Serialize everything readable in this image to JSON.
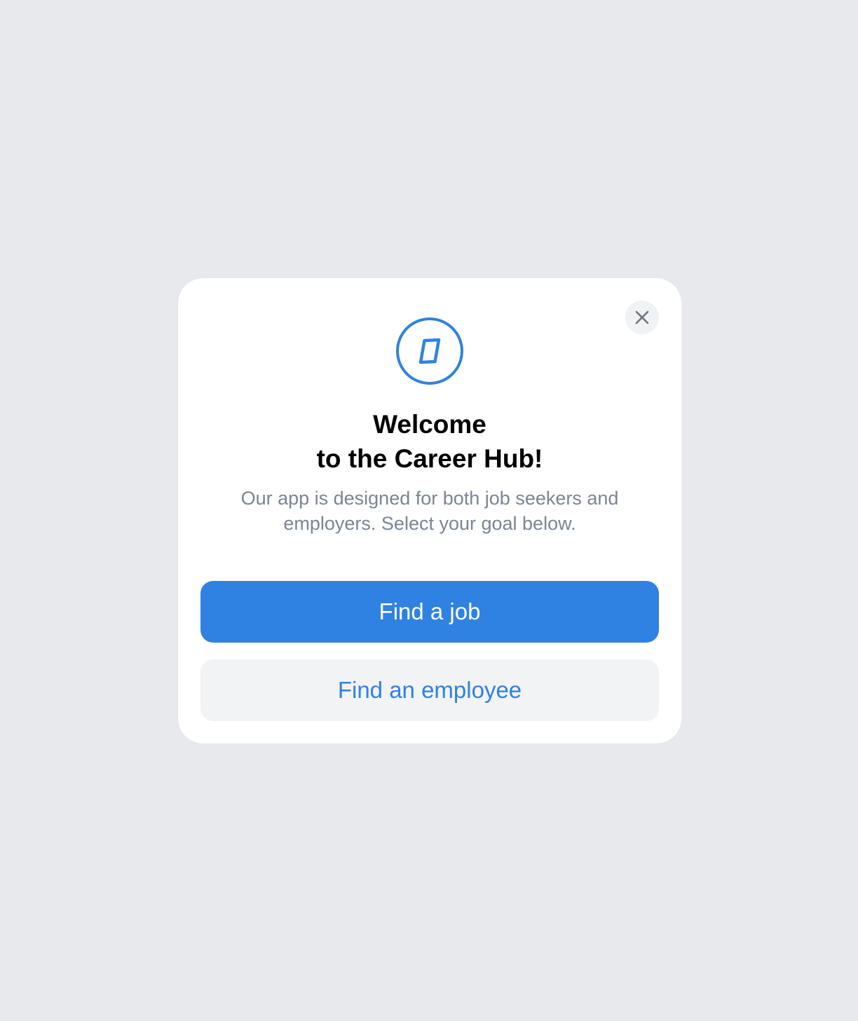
{
  "modal": {
    "close_icon": "close-icon",
    "logo_icon": "compass-icon",
    "title_line1": "Welcome",
    "title_line2": "to the Career Hub!",
    "subtitle_line1": "Our app is designed for both job seekers and",
    "subtitle_line2": "employers. Select your goal below.",
    "primary_button": "Find a job",
    "secondary_button": "Find an employee"
  },
  "colors": {
    "background": "#E7E9ED",
    "card": "#FFFFFF",
    "accent": "#2F82E1",
    "subtitle_text": "#7B8594",
    "close_button_bg": "#F1F2F4",
    "secondary_button_bg": "#F2F3F5"
  }
}
